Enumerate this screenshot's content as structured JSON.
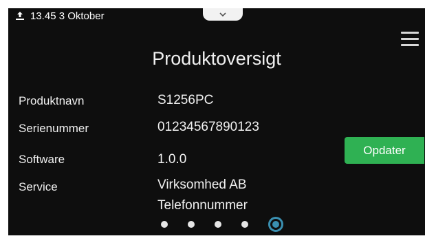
{
  "status": {
    "datetime": "13.45 3 Oktober",
    "icon": "upload-icon"
  },
  "header": {
    "title": "Produktoversigt",
    "menu_icon": "hamburger-menu-icon",
    "pull_tab_icon": "chevron-down-icon"
  },
  "product": {
    "rows": [
      {
        "label": "Produktnavn",
        "value": "S1256PC"
      },
      {
        "label": "Serienummer",
        "value": "01234567890123"
      },
      {
        "label": "Software",
        "value": "1.0.0"
      },
      {
        "label": "Service",
        "value": "Virksomhed AB",
        "value2": "Telefonnummer"
      }
    ]
  },
  "actions": {
    "update_label": "Opdater"
  },
  "pager": {
    "total": 5,
    "active": 5
  },
  "colors": {
    "background": "#0e0e0e",
    "accent_green": "#2fb153",
    "active_dot": "#3a8fb0"
  }
}
